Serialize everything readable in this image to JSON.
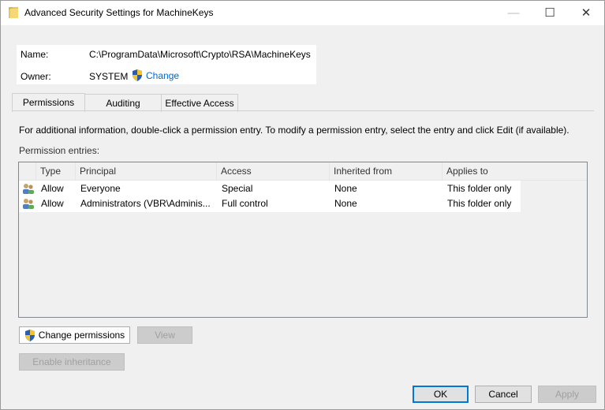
{
  "window": {
    "title": "Advanced Security Settings for MachineKeys",
    "icon": "folder-icon",
    "minimize": "—",
    "maximize": "☐",
    "close": "✕"
  },
  "info": {
    "name_label": "Name:",
    "name_value": "C:\\ProgramData\\Microsoft\\Crypto\\RSA\\MachineKeys",
    "owner_label": "Owner:",
    "owner_value": "SYSTEM",
    "owner_change": "Change"
  },
  "tabs": [
    {
      "label": "Permissions",
      "active": true
    },
    {
      "label": "Auditing",
      "active": false
    },
    {
      "label": "Effective Access",
      "active": false
    }
  ],
  "description": "For additional information, double-click a permission entry. To modify a permission entry, select the entry and click Edit (if available).",
  "entries_label": "Permission entries:",
  "columns": [
    "Type",
    "Principal",
    "Access",
    "Inherited from",
    "Applies to"
  ],
  "rows": [
    {
      "type": "Allow",
      "principal": "Everyone",
      "access": "Special",
      "inherited": "None",
      "applies": "This folder only"
    },
    {
      "type": "Allow",
      "principal": "Administrators (VBR\\Adminis...",
      "access": "Full control",
      "inherited": "None",
      "applies": "This folder only"
    }
  ],
  "buttons": {
    "change_permissions": "Change permissions",
    "view": "View",
    "enable_inheritance": "Enable inheritance",
    "ok": "OK",
    "cancel": "Cancel",
    "apply": "Apply"
  },
  "colors": {
    "link": "#0066cc",
    "accent": "#0078d7"
  }
}
